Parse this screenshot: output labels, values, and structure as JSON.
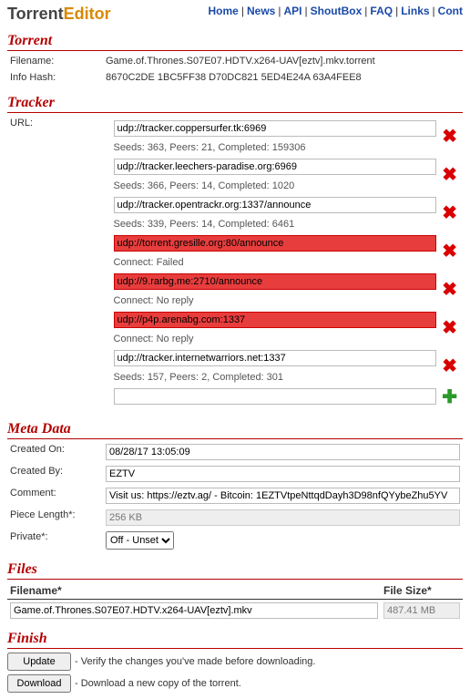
{
  "logo": {
    "part1": "Torrent",
    "part2": "Editor"
  },
  "nav": [
    {
      "label": "Home"
    },
    {
      "label": "News"
    },
    {
      "label": "API"
    },
    {
      "label": "ShoutBox"
    },
    {
      "label": "FAQ"
    },
    {
      "label": "Links"
    },
    {
      "label": "Cont"
    }
  ],
  "sections": {
    "torrent": "Torrent",
    "tracker": "Tracker",
    "meta": "Meta Data",
    "files": "Files",
    "finish": "Finish"
  },
  "torrent": {
    "filename_label": "Filename:",
    "filename": "Game.of.Thrones.S07E07.HDTV.x264-UAV[eztv].mkv.torrent",
    "infohash_label": "Info Hash:",
    "infohash": "8670C2DE 1BC5FF38 D70DC821 5ED4E24A 63A4FEE8"
  },
  "tracker": {
    "url_label": "URL:",
    "trackers": [
      {
        "url": "udp://tracker.coppersurfer.tk:6969",
        "status": "Seeds: 363, Peers: 21, Completed: 159306",
        "bad": false
      },
      {
        "url": "udp://tracker.leechers-paradise.org:6969",
        "status": "Seeds: 366, Peers: 14, Completed: 1020",
        "bad": false
      },
      {
        "url": "udp://tracker.opentrackr.org:1337/announce",
        "status": "Seeds: 339, Peers: 14, Completed: 6461",
        "bad": false
      },
      {
        "url": "udp://torrent.gresille.org:80/announce",
        "status": "Connect: Failed",
        "bad": true
      },
      {
        "url": "udp://9.rarbg.me:2710/announce",
        "status": "Connect: No reply",
        "bad": true
      },
      {
        "url": "udp://p4p.arenabg.com:1337",
        "status": "Connect: No reply",
        "bad": true
      },
      {
        "url": "udp://tracker.internetwarriors.net:1337",
        "status": "Seeds: 157, Peers: 2, Completed: 301",
        "bad": false
      }
    ]
  },
  "meta": {
    "created_on_label": "Created On:",
    "created_on": "08/28/17 13:05:09",
    "created_by_label": "Created By:",
    "created_by": "EZTV",
    "comment_label": "Comment:",
    "comment": "Visit us: https://eztv.ag/ - Bitcoin: 1EZTVtpeNttqdDayh3D98nfQYybeZhu5YV",
    "piece_length_label": "Piece Length*:",
    "piece_length": "256 KB",
    "private_label": "Private*:",
    "private_value": "Off - Unset"
  },
  "files": {
    "col_name": "Filename*",
    "col_size": "File Size*",
    "rows": [
      {
        "name": "Game.of.Thrones.S07E07.HDTV.x264-UAV[eztv].mkv",
        "size": "487.41 MB"
      }
    ]
  },
  "finish": {
    "update_btn": "Update",
    "download_btn": "Download",
    "update_desc": "- Verify the changes you've made before downloading.",
    "download_desc": "- Download a new copy of the torrent."
  }
}
